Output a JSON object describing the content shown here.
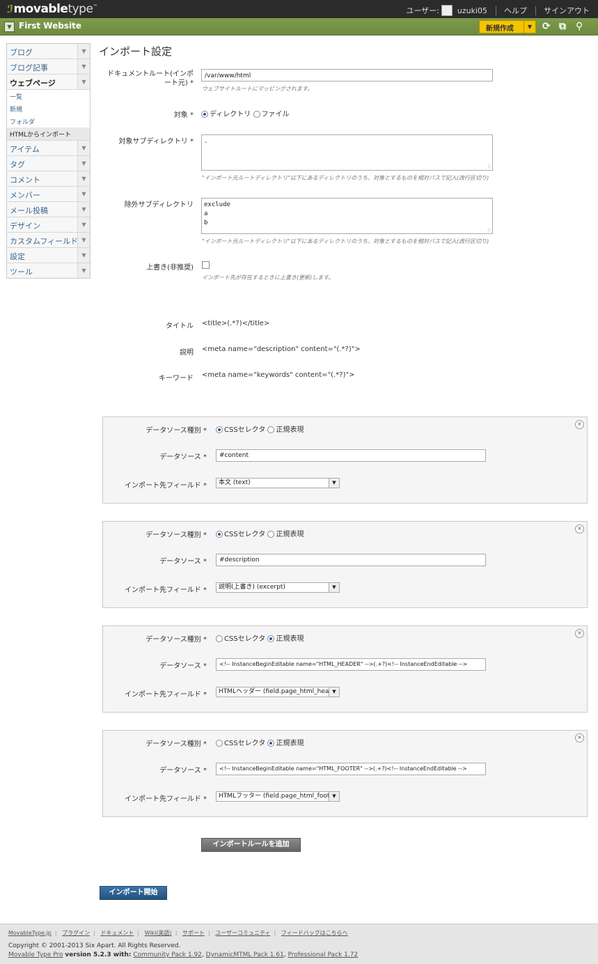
{
  "header": {
    "logo_main": "movable",
    "logo_thin": "type",
    "logo_tm": "™",
    "user_label": "ユーザー:",
    "username": "uzuki05",
    "help": "ヘルプ",
    "signout": "サインアウト"
  },
  "sitebar": {
    "site_name": "First Website",
    "new_button": "新規作成"
  },
  "sidebar": {
    "items_top": [
      {
        "label": "ブログ"
      },
      {
        "label": "ブログ記事"
      },
      {
        "label": "ウェブページ"
      }
    ],
    "subitems": [
      {
        "label": "一覧"
      },
      {
        "label": "新規"
      },
      {
        "label": "フォルダ"
      },
      {
        "label": "HTMLからインポート"
      }
    ],
    "items_bottom": [
      {
        "label": "アイテム"
      },
      {
        "label": "タグ"
      },
      {
        "label": "コメント"
      },
      {
        "label": "メンバー"
      },
      {
        "label": "メール投稿"
      },
      {
        "label": "デザイン"
      },
      {
        "label": "カスタムフィールド"
      },
      {
        "label": "設定"
      },
      {
        "label": "ツール"
      }
    ]
  },
  "page": {
    "title": "インポート設定",
    "doc_root_label": "ドキュメントルート(インポート元) *",
    "doc_root_value": "/var/www/html",
    "doc_root_hint": "ウェブサイトルートにマッピングされます。",
    "target_label": "対象 *",
    "target_dir": "ディレクトリ",
    "target_file": "ファイル",
    "subdir_label": "対象サブディレクトリ *",
    "subdir_value": ".",
    "subdir_hint": "\"インポート元ルートディレクトリ\"以下にあるディレクトリのうち、対象とするものを相対パスで記入(改行区切り)",
    "exclude_label": "除外サブディレクトリ",
    "exclude_value": "exclude\na\nb",
    "exclude_hint": "\"インポート元ルートディレクトリ\"以下にあるディレクトリのうち、対象とするものを相対パスで記入(改行区切り)",
    "overwrite_label": "上書き(非推奨)",
    "overwrite_hint": "インポート先が存在するときに上書き(更新)します。",
    "title_label": "タイトル",
    "title_value": "<title>(.*?)</title>",
    "desc_label": "説明",
    "desc_value": "<meta name=\"description\" content=\"(.*?)\">",
    "kw_label": "キーワード",
    "kw_value": "<meta name=\"keywords\" content=\"(.*?)\">"
  },
  "rules_labels": {
    "type": "データソース種別 *",
    "css": "CSSセレクタ",
    "regex": "正規表現",
    "source": "データソース *",
    "field": "インポート先フィールド *"
  },
  "rules": [
    {
      "type": "css",
      "source": "#content",
      "field": "本文 (text)"
    },
    {
      "type": "css",
      "source": "#description",
      "field": "説明(上書き) (excerpt)"
    },
    {
      "type": "regex",
      "source": "<!-- InstanceBeginEditable name=\"HTML_HEADER\" -->(.+?)<!-- InstanceEndEditable -->",
      "field": "HTMLヘッダー (field.page_html_header)"
    },
    {
      "type": "regex",
      "source": "<!-- InstanceBeginEditable name=\"HTML_FOOTER\" -->(.+?)<!-- InstanceEndEditable -->",
      "field": "HTMLフッター (field.page_html_footer)"
    }
  ],
  "buttons": {
    "add_rule": "インポートルールを追加",
    "start": "インポート開始"
  },
  "footer": {
    "links": [
      "MovableType.jp",
      "プラグイン",
      "ドキュメント",
      "Wiki(英語)",
      "サポート",
      "ユーザーコミュニティ",
      "フィードバックはこちらへ"
    ],
    "copyright": "Copyright © 2001-2013 Six Apart. All Rights Reserved.",
    "product": "Movable Type Pro",
    "version": "version 5.2.3 with:",
    "packs": [
      "Community Pack 1.92",
      "DynamicMTML Pack 1.61",
      "Professional Pack 1.72"
    ]
  }
}
